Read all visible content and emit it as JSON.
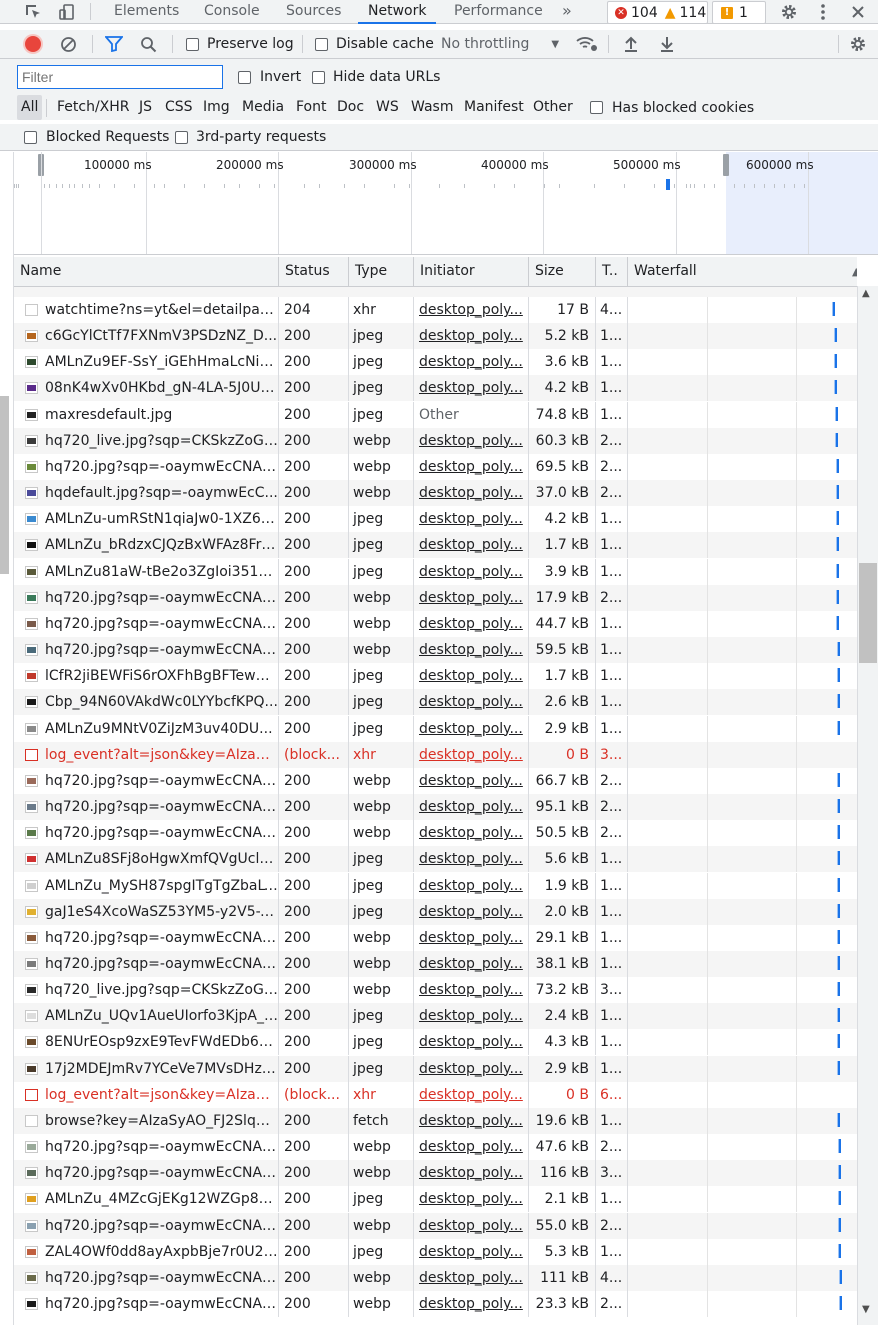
{
  "tabs": {
    "elements": "Elements",
    "console": "Console",
    "sources": "Sources",
    "network": "Network",
    "performance": "Performance",
    "more": "»",
    "errors_count": "104",
    "warnings_count": "114",
    "issues_count": "1"
  },
  "toolbar": {
    "preserve_log": "Preserve log",
    "disable_cache": "Disable cache",
    "throttling": "No throttling"
  },
  "filter": {
    "placeholder": "Filter",
    "invert": "Invert",
    "hide_data_urls": "Hide data URLs",
    "has_blocked_cookies": "Has blocked cookies",
    "blocked_requests": "Blocked Requests",
    "third_party": "3rd-party requests"
  },
  "types": [
    "All",
    "Fetch/XHR",
    "JS",
    "CSS",
    "Img",
    "Media",
    "Font",
    "Doc",
    "WS",
    "Wasm",
    "Manifest",
    "Other"
  ],
  "overview": {
    "ticks": [
      "100000 ms",
      "200000 ms",
      "300000 ms",
      "400000 ms",
      "500000 ms",
      "600000 ms"
    ]
  },
  "columns": {
    "name": "Name",
    "status": "Status",
    "type": "Type",
    "initiator": "Initiator",
    "size": "Size",
    "time": "T..",
    "waterfall": "Waterfall"
  },
  "requests": [
    {
      "name": "watchtime?ns=yt&el=detailpage...",
      "status": "204",
      "type": "xhr",
      "initiator": "desktop_poly...",
      "size": "17 B",
      "time": "4...",
      "thumb": "doc",
      "blocked": false
    },
    {
      "name": "c6GcYlCtTf7FXNmV3PSDzNZ_D...",
      "status": "200",
      "type": "jpeg",
      "initiator": "desktop_poly...",
      "size": "5.2 kB",
      "time": "1...",
      "thumb": "#b5651d",
      "blocked": false
    },
    {
      "name": "AMLnZu9EF-SsY_iGEhHmaLcNiy...",
      "status": "200",
      "type": "jpeg",
      "initiator": "desktop_poly...",
      "size": "3.6 kB",
      "time": "1...",
      "thumb": "#2e4a2e",
      "blocked": false
    },
    {
      "name": "08nK4wXv0HKbd_gN-4LA-5J0U-...",
      "status": "200",
      "type": "jpeg",
      "initiator": "desktop_poly...",
      "size": "4.2 kB",
      "time": "1...",
      "thumb": "#5a2a8a",
      "blocked": false
    },
    {
      "name": "maxresdefault.jpg",
      "status": "200",
      "type": "jpeg",
      "initiator": "Other",
      "size": "74.8 kB",
      "time": "1...",
      "thumb": "#222222",
      "blocked": false
    },
    {
      "name": "hq720_live.jpg?sqp=CKSkzZoG-...",
      "status": "200",
      "type": "webp",
      "initiator": "desktop_poly...",
      "size": "60.3 kB",
      "time": "2...",
      "thumb": "#3a3a3a",
      "blocked": false
    },
    {
      "name": "hq720.jpg?sqp=-oaymwEcCNAF...",
      "status": "200",
      "type": "webp",
      "initiator": "desktop_poly...",
      "size": "69.5 kB",
      "time": "2...",
      "thumb": "#6a8a3a",
      "blocked": false
    },
    {
      "name": "hqdefault.jpg?sqp=-oaymwEcC...",
      "status": "200",
      "type": "webp",
      "initiator": "desktop_poly...",
      "size": "37.0 kB",
      "time": "2...",
      "thumb": "#4a4a9a",
      "blocked": false
    },
    {
      "name": "AMLnZu-umRStN1qiaJw0-1XZ6E...",
      "status": "200",
      "type": "jpeg",
      "initiator": "desktop_poly...",
      "size": "4.2 kB",
      "time": "1...",
      "thumb": "#3a8ad0",
      "blocked": false
    },
    {
      "name": "AMLnZu_bRdzxCJQzBxWFAz8Fr1...",
      "status": "200",
      "type": "jpeg",
      "initiator": "desktop_poly...",
      "size": "1.7 kB",
      "time": "1...",
      "thumb": "#111111",
      "blocked": false
    },
    {
      "name": "AMLnZu81aW-tBe2o3ZgIoi351u...",
      "status": "200",
      "type": "jpeg",
      "initiator": "desktop_poly...",
      "size": "3.9 kB",
      "time": "1...",
      "thumb": "#5a5a3a",
      "blocked": false
    },
    {
      "name": "hq720.jpg?sqp=-oaymwEcCNAF...",
      "status": "200",
      "type": "webp",
      "initiator": "desktop_poly...",
      "size": "17.9 kB",
      "time": "2...",
      "thumb": "#3a7a5a",
      "blocked": false
    },
    {
      "name": "hq720.jpg?sqp=-oaymwEcCNAF...",
      "status": "200",
      "type": "webp",
      "initiator": "desktop_poly...",
      "size": "44.7 kB",
      "time": "1...",
      "thumb": "#7a5a4a",
      "blocked": false
    },
    {
      "name": "hq720.jpg?sqp=-oaymwEcCNAF...",
      "status": "200",
      "type": "webp",
      "initiator": "desktop_poly...",
      "size": "59.5 kB",
      "time": "1...",
      "thumb": "#4a6a7a",
      "blocked": false
    },
    {
      "name": "lCfR2jiBEWFiS6rOXFhBgBFTewuf...",
      "status": "200",
      "type": "jpeg",
      "initiator": "desktop_poly...",
      "size": "1.7 kB",
      "time": "1...",
      "thumb": "#c0392b",
      "blocked": false
    },
    {
      "name": "Cbp_94N60VAkdWc0LYYbcfKPQ...",
      "status": "200",
      "type": "jpeg",
      "initiator": "desktop_poly...",
      "size": "2.6 kB",
      "time": "1...",
      "thumb": "#1a1a1a",
      "blocked": false
    },
    {
      "name": "AMLnZu9MNtV0ZiJzM3uv40DU...",
      "status": "200",
      "type": "jpeg",
      "initiator": "desktop_poly...",
      "size": "2.9 kB",
      "time": "1...",
      "thumb": "#8a8a8a",
      "blocked": false
    },
    {
      "name": "log_event?alt=json&key=AIzaSy...",
      "status": "(block...",
      "type": "xhr",
      "initiator": "desktop_poly...",
      "size": "0 B",
      "time": "3...",
      "thumb": "doc",
      "blocked": true
    },
    {
      "name": "hq720.jpg?sqp=-oaymwEcCNAF...",
      "status": "200",
      "type": "webp",
      "initiator": "desktop_poly...",
      "size": "66.7 kB",
      "time": "2...",
      "thumb": "#9a6a5a",
      "blocked": false
    },
    {
      "name": "hq720.jpg?sqp=-oaymwEcCNAF...",
      "status": "200",
      "type": "webp",
      "initiator": "desktop_poly...",
      "size": "95.1 kB",
      "time": "2...",
      "thumb": "#6a7a8a",
      "blocked": false
    },
    {
      "name": "hq720.jpg?sqp=-oaymwEcCNAF...",
      "status": "200",
      "type": "webp",
      "initiator": "desktop_poly...",
      "size": "50.5 kB",
      "time": "2...",
      "thumb": "#5a7a4a",
      "blocked": false
    },
    {
      "name": "AMLnZu8SFj8oHgwXmfQVgUclu...",
      "status": "200",
      "type": "jpeg",
      "initiator": "desktop_poly...",
      "size": "5.6 kB",
      "time": "1...",
      "thumb": "#d03030",
      "blocked": false
    },
    {
      "name": "AMLnZu_MySH87spgITgTgZbaLV...",
      "status": "200",
      "type": "jpeg",
      "initiator": "desktop_poly...",
      "size": "1.9 kB",
      "time": "1...",
      "thumb": "#cfcfcf",
      "blocked": false
    },
    {
      "name": "gaJ1eS4XcoWaSZ53YM5-y2V5-X...",
      "status": "200",
      "type": "jpeg",
      "initiator": "desktop_poly...",
      "size": "2.0 kB",
      "time": "1...",
      "thumb": "#e0b030",
      "blocked": false
    },
    {
      "name": "hq720.jpg?sqp=-oaymwEcCNAF...",
      "status": "200",
      "type": "webp",
      "initiator": "desktop_poly...",
      "size": "29.1 kB",
      "time": "1...",
      "thumb": "#8a5a3a",
      "blocked": false
    },
    {
      "name": "hq720.jpg?sqp=-oaymwEcCNAF...",
      "status": "200",
      "type": "webp",
      "initiator": "desktop_poly...",
      "size": "38.1 kB",
      "time": "1...",
      "thumb": "#7a7a7a",
      "blocked": false
    },
    {
      "name": "hq720_live.jpg?sqp=CKSkzZoG-...",
      "status": "200",
      "type": "webp",
      "initiator": "desktop_poly...",
      "size": "73.2 kB",
      "time": "3...",
      "thumb": "#2a2a2a",
      "blocked": false
    },
    {
      "name": "AMLnZu_UQv1AueUIorfo3KjpA_j...",
      "status": "200",
      "type": "jpeg",
      "initiator": "desktop_poly...",
      "size": "2.4 kB",
      "time": "1...",
      "thumb": "#dddddd",
      "blocked": false
    },
    {
      "name": "8ENUrEOsp9zxE9TevFWdEDb6C...",
      "status": "200",
      "type": "jpeg",
      "initiator": "desktop_poly...",
      "size": "4.3 kB",
      "time": "1...",
      "thumb": "#6a4a2a",
      "blocked": false
    },
    {
      "name": "17j2MDEJmRv7YCeVe7MVsDHzL...",
      "status": "200",
      "type": "jpeg",
      "initiator": "desktop_poly...",
      "size": "2.9 kB",
      "time": "1...",
      "thumb": "#4a3a2a",
      "blocked": false
    },
    {
      "name": "log_event?alt=json&key=AIzaSy...",
      "status": "(block...",
      "type": "xhr",
      "initiator": "desktop_poly...",
      "size": "0 B",
      "time": "6...",
      "thumb": "doc",
      "blocked": true
    },
    {
      "name": "browse?key=AIzaSyAO_FJ2SlqU8...",
      "status": "200",
      "type": "fetch",
      "initiator": "desktop_poly...",
      "size": "19.6 kB",
      "time": "1...",
      "thumb": "doc",
      "blocked": false
    },
    {
      "name": "hq720.jpg?sqp=-oaymwEcCNAF...",
      "status": "200",
      "type": "webp",
      "initiator": "desktop_poly...",
      "size": "47.6 kB",
      "time": "2...",
      "thumb": "#9aaa9a",
      "blocked": false
    },
    {
      "name": "hq720.jpg?sqp=-oaymwEcCNAF...",
      "status": "200",
      "type": "webp",
      "initiator": "desktop_poly...",
      "size": "116 kB",
      "time": "3...",
      "thumb": "#5a6a5a",
      "blocked": false
    },
    {
      "name": "AMLnZu_4MZcGjEKg12WZGp8U...",
      "status": "200",
      "type": "jpeg",
      "initiator": "desktop_poly...",
      "size": "2.1 kB",
      "time": "1...",
      "thumb": "#e0a020",
      "blocked": false
    },
    {
      "name": "hq720.jpg?sqp=-oaymwEcCNAF...",
      "status": "200",
      "type": "webp",
      "initiator": "desktop_poly...",
      "size": "55.0 kB",
      "time": "2...",
      "thumb": "#8aa0b0",
      "blocked": false
    },
    {
      "name": "ZAL4OWf0dd8ayAxpbBje7r0U2n...",
      "status": "200",
      "type": "jpeg",
      "initiator": "desktop_poly...",
      "size": "5.3 kB",
      "time": "1...",
      "thumb": "#c06040",
      "blocked": false
    },
    {
      "name": "hq720.jpg?sqp=-oaymwEcCNAF...",
      "status": "200",
      "type": "webp",
      "initiator": "desktop_poly...",
      "size": "111 kB",
      "time": "4...",
      "thumb": "#6a6a4a",
      "blocked": false
    },
    {
      "name": "hq720.jpg?sqp=-oaymwEcCNAF...",
      "status": "200",
      "type": "webp",
      "initiator": "desktop_poly...",
      "size": "23.3 kB",
      "time": "2...",
      "thumb": "#1a1a1a",
      "blocked": false
    }
  ],
  "colors": {
    "accent": "#1a73e8",
    "error": "#d93025",
    "record": "#e8453c",
    "waterfall": "#1a73e8"
  }
}
